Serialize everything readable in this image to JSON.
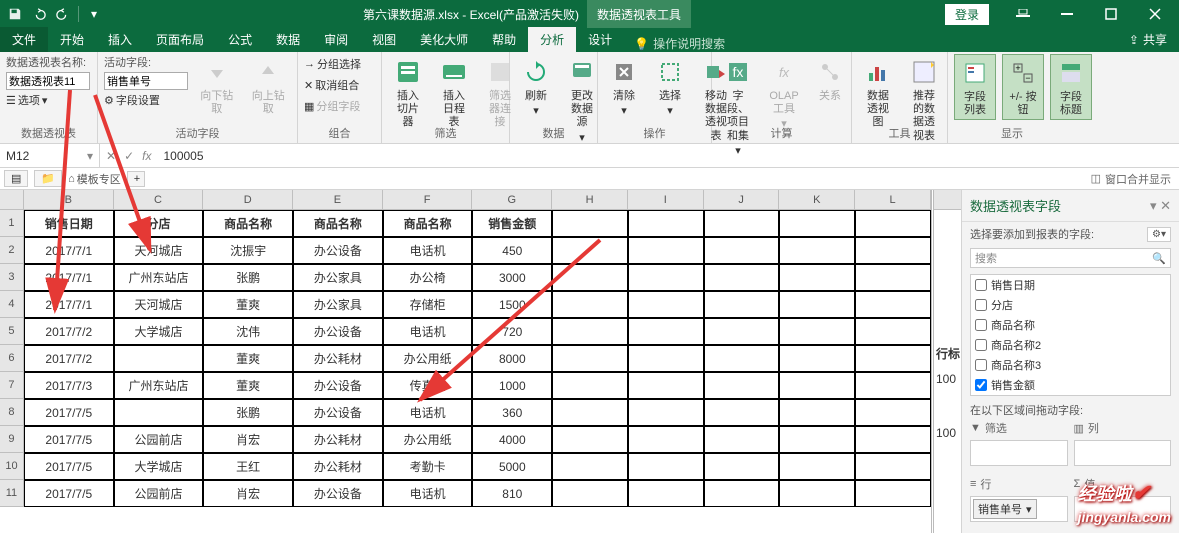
{
  "title": "第六课数据源.xlsx - Excel(产品激活失败)",
  "context_tab": "数据透视表工具",
  "login": "登录",
  "share": "共享",
  "tellme": "操作说明搜索",
  "menutabs": [
    "文件",
    "开始",
    "插入",
    "页面布局",
    "公式",
    "数据",
    "审阅",
    "视图",
    "美化大师",
    "帮助",
    "分析",
    "设计"
  ],
  "active_tab": "分析",
  "ribbon": {
    "g1": {
      "label": "数据透视表",
      "name_label": "数据透视表名称:",
      "name_value": "数据透视表11",
      "opt": "选项"
    },
    "g2": {
      "label": "活动字段",
      "field_label": "活动字段:",
      "field_value": "销售单号",
      "setting": "字段设置",
      "drill_down": "向下钻取",
      "drill_up": "向上钻取"
    },
    "g3": {
      "label": "组合",
      "a": "分组选择",
      "b": "取消组合",
      "c": "分组字段"
    },
    "g4": {
      "label": "筛选",
      "a": "插入切片器",
      "b": "插入日程表",
      "c": "筛选器连接"
    },
    "g5": {
      "label": "数据",
      "a": "刷新",
      "b": "更改数据源"
    },
    "g6": {
      "label": "操作",
      "a": "清除",
      "b": "选择",
      "c": "移动数据透视表"
    },
    "g7": {
      "label": "计算",
      "a": "字段、项目和集",
      "b": "OLAP 工具",
      "c": "关系"
    },
    "g8": {
      "label": "工具",
      "a": "数据透视图",
      "b": "推荐的数据透视表"
    },
    "g9": {
      "label": "显示",
      "a": "字段列表",
      "b": "+/- 按钮",
      "c": "字段标题"
    }
  },
  "namebox": "M12",
  "formula": "100005",
  "sheettab_template": "模板专区",
  "window_merge": "窗口合并显示",
  "columns": [
    "",
    "B",
    "C",
    "D",
    "E",
    "F",
    "G",
    "H",
    "I",
    "J",
    "K",
    "L"
  ],
  "headers": [
    "销售日期",
    "分店",
    "商品名称",
    "商品名称",
    "商品名称",
    "销售金额"
  ],
  "rows": [
    {
      "n": 2,
      "d": [
        "2017/7/1",
        "天河城店",
        "沈振宇",
        "办公设备",
        "电话机",
        "450"
      ]
    },
    {
      "n": 3,
      "d": [
        "2017/7/1",
        "广州东站店",
        "张鹏",
        "办公家具",
        "办公椅",
        "3000"
      ]
    },
    {
      "n": 4,
      "d": [
        "2017/7/1",
        "天河城店",
        "董爽",
        "办公家具",
        "存储柜",
        "1500"
      ]
    },
    {
      "n": 5,
      "d": [
        "2017/7/2",
        "大学城店",
        "沈伟",
        "办公设备",
        "电话机",
        "720"
      ]
    },
    {
      "n": 6,
      "d": [
        "2017/7/2",
        "",
        "董爽",
        "办公耗材",
        "办公用纸",
        "8000"
      ]
    },
    {
      "n": 7,
      "d": [
        "2017/7/3",
        "广州东站店",
        "董爽",
        "办公设备",
        "传真机",
        "1000"
      ]
    },
    {
      "n": 8,
      "d": [
        "2017/7/5",
        "",
        "张鹏",
        "办公设备",
        "电话机",
        "360"
      ]
    },
    {
      "n": 9,
      "d": [
        "2017/7/5",
        "公园前店",
        "肖宏",
        "办公耗材",
        "办公用纸",
        "4000"
      ]
    },
    {
      "n": 10,
      "d": [
        "2017/7/5",
        "大学城店",
        "王红",
        "办公耗材",
        "考勤卡",
        "5000"
      ]
    },
    {
      "n": 11,
      "d": [
        "2017/7/5",
        "公园前店",
        "肖宏",
        "办公设备",
        "电话机",
        "810"
      ]
    }
  ],
  "pivot_preview": {
    "r7": "行标",
    "r8": "100",
    "r10": "100"
  },
  "fieldpane": {
    "title": "数据透视表字段",
    "sub": "选择要添加到报表的字段:",
    "search": "搜索",
    "fields": [
      {
        "label": "销售日期",
        "checked": false
      },
      {
        "label": "分店",
        "checked": false
      },
      {
        "label": "商品名称",
        "checked": false
      },
      {
        "label": "商品名称2",
        "checked": false
      },
      {
        "label": "商品名称3",
        "checked": false
      },
      {
        "label": "销售金额",
        "checked": true
      }
    ],
    "drag_label": "在以下区域间拖动字段:",
    "filter": "筛选",
    "cols": "列",
    "rows": "行",
    "vals": "值",
    "chip": "销售单号"
  },
  "watermark": {
    "cn": "经验啦",
    "en": "jingyanla.com"
  }
}
